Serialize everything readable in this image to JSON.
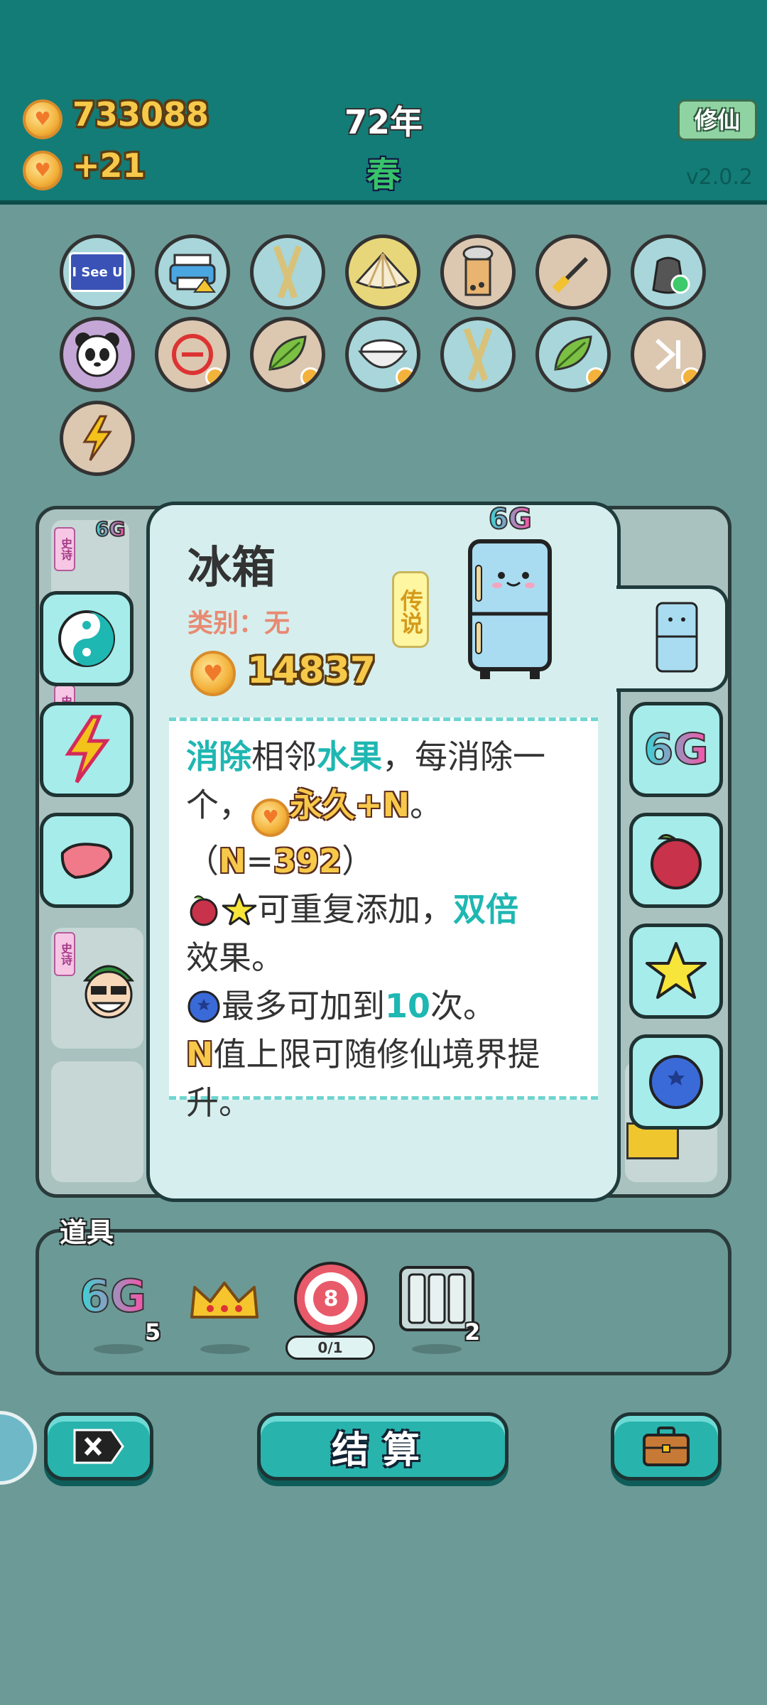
{
  "header": {
    "coins": "733088",
    "income": "+21",
    "year": "72年",
    "season": "春",
    "xiuxian_button": "修仙",
    "version": "v2.0.2"
  },
  "grid": {
    "row1": [
      "I See U",
      "printer-icon",
      "chopsticks-icon",
      "shell-icon",
      "bubble-tea-icon",
      "screwdriver-icon",
      "trash-bag-icon"
    ],
    "row2": [
      "panda-icon",
      "minus-icon",
      "leaf-icon",
      "rice-bowl-icon",
      "chopsticks-icon",
      "leaf-icon",
      "skip-icon"
    ],
    "row3": [
      "lightning-icon"
    ]
  },
  "board": {
    "tags": [
      "史诗",
      "史诗",
      "史诗"
    ],
    "badge_6g": "6G"
  },
  "popup": {
    "title": "冰箱",
    "category": "类别：无",
    "rarity": "传说",
    "price": "14837",
    "tag_6g": "6G",
    "desc": {
      "l1_a": "消除",
      "l1_b": "相邻",
      "l1_c": "水果",
      "l1_d": "，每消除一",
      "l2_a": "个，",
      "l2_b": "永久+N",
      "l2_c": "。",
      "l3_a": "（",
      "l3_b": "N",
      "l3_c": "=",
      "l3_d": "392",
      "l3_e": "）",
      "l4_a": "可重复添加，",
      "l4_b": "双倍",
      "l5": "效果。",
      "l6_a": "最多可加到",
      "l6_b": "10",
      "l6_c": "次。",
      "l7_a": "N",
      "l7_b": "值上限可随修仙境界提",
      "l8": "升。"
    }
  },
  "side_right": {
    "tile_6g": "6G"
  },
  "props": {
    "label": "道具",
    "items": [
      {
        "name": "6G",
        "count": "5"
      },
      {
        "name": "crown",
        "count": ""
      },
      {
        "name": "target",
        "value": "8",
        "progress": "0/1"
      },
      {
        "name": "slots",
        "count": "2"
      }
    ]
  },
  "buttons": {
    "settle": "结算"
  },
  "colors": {
    "topbar": "#137c77",
    "accent": "#1fb7b2",
    "gold": "#f7c94a",
    "background": "#6c9a97"
  }
}
